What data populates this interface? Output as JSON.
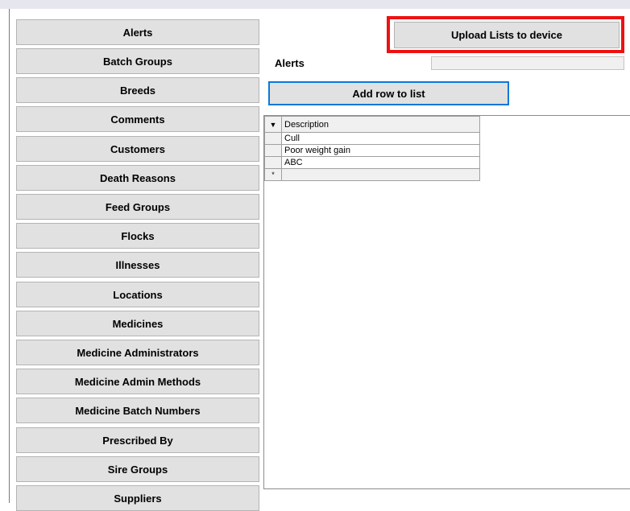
{
  "sidebar": {
    "items": [
      "Alerts",
      "Batch Groups",
      "Breeds",
      "Comments",
      "Customers",
      "Death Reasons",
      "Feed Groups",
      "Flocks",
      "Illnesses",
      "Locations",
      "Medicines",
      "Medicine Administrators",
      "Medicine Admin Methods",
      "Medicine Batch Numbers",
      "Prescribed By",
      "Sire Groups",
      "Suppliers"
    ]
  },
  "toolbar": {
    "upload_label": "Upload Lists to device",
    "add_row_label": "Add row to list"
  },
  "list": {
    "label": "Alerts",
    "value": ""
  },
  "grid": {
    "header": "Description",
    "header_glyph": "▼",
    "new_row_glyph": "*",
    "rows": [
      "Cull",
      "Poor weight gain",
      "ABC"
    ]
  },
  "colors": {
    "highlight": "#ee1111",
    "focus": "#0a78d7"
  }
}
